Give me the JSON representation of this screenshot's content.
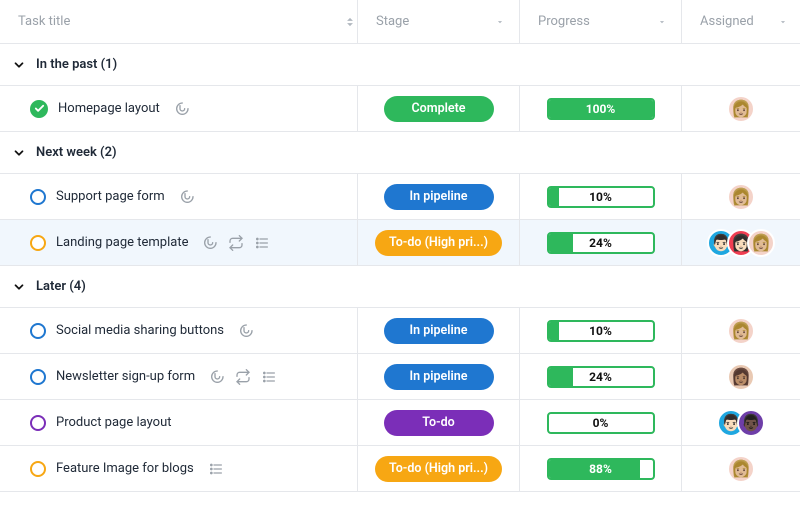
{
  "columns": {
    "title": "Task title",
    "stage": "Stage",
    "progress": "Progress",
    "assigned": "Assigned"
  },
  "groups": [
    {
      "label": "In the past (1)",
      "tasks": [
        {
          "title": "Homepage layout",
          "status": "complete",
          "status_color": "#2eb85c",
          "icons": [
            "attachment"
          ],
          "stage": {
            "text": "Complete",
            "color": "green"
          },
          "progress": {
            "percent": 100,
            "text": "100%"
          },
          "assignees": [
            {
              "emoji": "👩🏼",
              "bg": "av-bg-1"
            }
          ],
          "highlight": false
        }
      ]
    },
    {
      "label": "Next week (2)",
      "tasks": [
        {
          "title": "Support page form",
          "status": "ring",
          "status_color": "#1f77d0",
          "icons": [
            "attachment"
          ],
          "stage": {
            "text": "In pipeline",
            "color": "blue"
          },
          "progress": {
            "percent": 10,
            "text": "10%"
          },
          "assignees": [
            {
              "emoji": "👩🏼",
              "bg": "av-bg-1"
            }
          ],
          "highlight": false
        },
        {
          "title": "Landing page template",
          "status": "ring",
          "status_color": "#f7a713",
          "icons": [
            "attachment",
            "repeat",
            "list"
          ],
          "stage": {
            "text": "To-do (High pri...)",
            "color": "orange"
          },
          "progress": {
            "percent": 24,
            "text": "24%"
          },
          "assignees": [
            {
              "emoji": "👨🏻",
              "bg": "av-bg-2"
            },
            {
              "emoji": "👩🏻",
              "bg": "av-bg-3"
            },
            {
              "emoji": "👩🏼",
              "bg": "av-bg-1"
            }
          ],
          "highlight": true
        }
      ]
    },
    {
      "label": "Later (4)",
      "tasks": [
        {
          "title": "Social media sharing buttons",
          "status": "ring",
          "status_color": "#1f77d0",
          "icons": [
            "attachment"
          ],
          "stage": {
            "text": "In pipeline",
            "color": "blue"
          },
          "progress": {
            "percent": 10,
            "text": "10%"
          },
          "assignees": [
            {
              "emoji": "👩🏼",
              "bg": "av-bg-1"
            }
          ],
          "highlight": false
        },
        {
          "title": "Newsletter sign-up form",
          "status": "ring",
          "status_color": "#1f77d0",
          "icons": [
            "attachment",
            "repeat",
            "list"
          ],
          "stage": {
            "text": "In pipeline",
            "color": "blue"
          },
          "progress": {
            "percent": 24,
            "text": "24%"
          },
          "assignees": [
            {
              "emoji": "👩🏽",
              "bg": "av-bg-4"
            }
          ],
          "highlight": false
        },
        {
          "title": "Product page layout",
          "status": "ring",
          "status_color": "#7b2eb8",
          "icons": [],
          "stage": {
            "text": "To-do",
            "color": "purple"
          },
          "progress": {
            "percent": 0,
            "text": "0%"
          },
          "assignees": [
            {
              "emoji": "👨🏻",
              "bg": "av-bg-2"
            },
            {
              "emoji": "👨🏿",
              "bg": "av-bg-5"
            }
          ],
          "highlight": false
        },
        {
          "title": "Feature Image for blogs",
          "status": "ring",
          "status_color": "#f7a713",
          "icons": [
            "list"
          ],
          "stage": {
            "text": "To-do (High pri...)",
            "color": "orange"
          },
          "progress": {
            "percent": 88,
            "text": "88%"
          },
          "assignees": [
            {
              "emoji": "👩🏼",
              "bg": "av-bg-1"
            }
          ],
          "highlight": false
        }
      ]
    }
  ]
}
